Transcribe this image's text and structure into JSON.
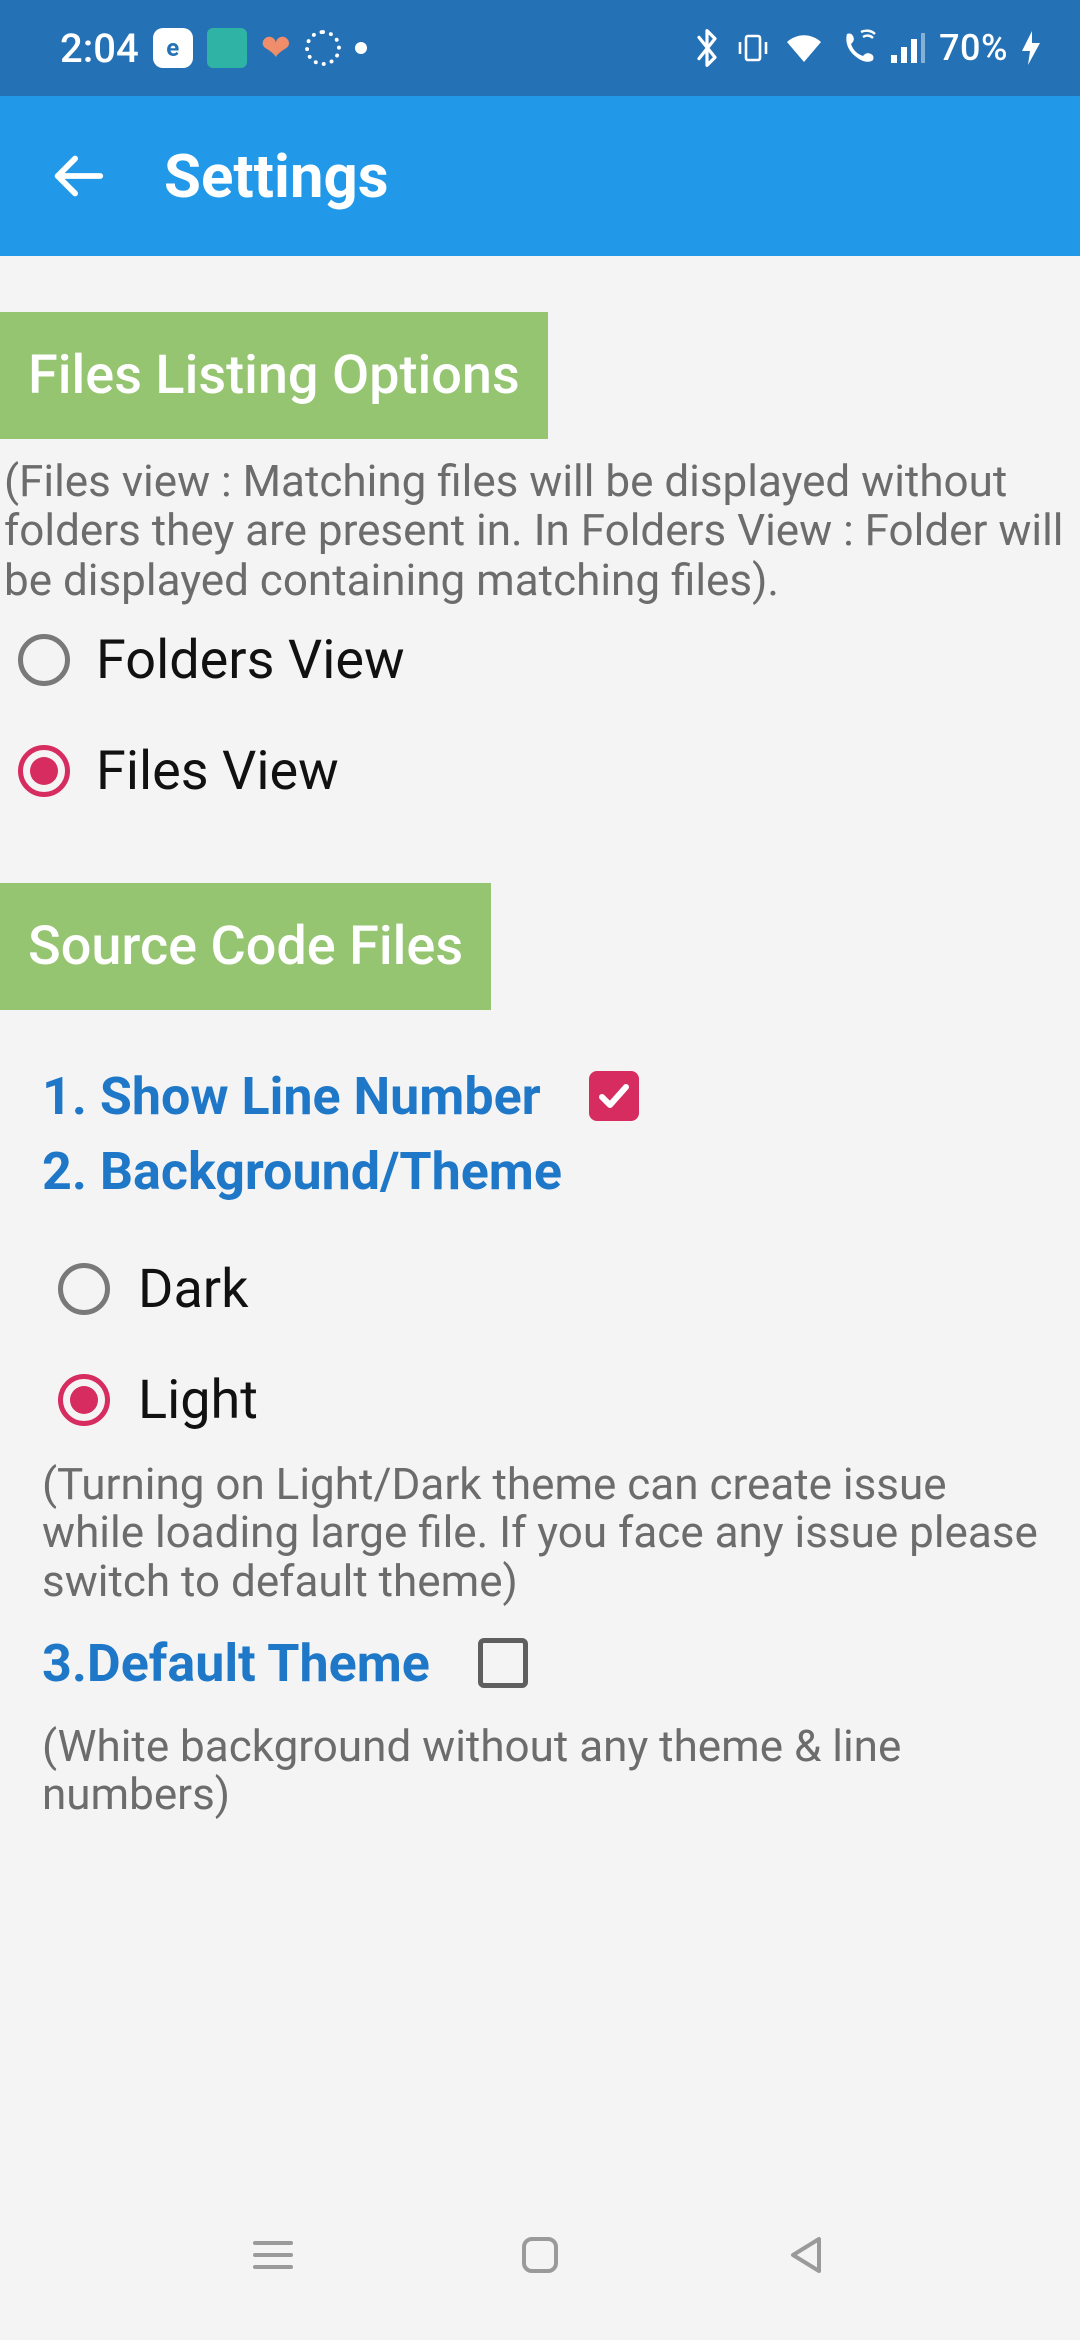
{
  "status": {
    "time": "2:04",
    "battery": "70%"
  },
  "appbar": {
    "title": "Settings"
  },
  "section_files": {
    "header": "Files Listing Options",
    "desc": "(Files view : Matching files will be displayed without folders they are present in. In Folders View : Folder will be displayed containing matching files).",
    "radio_folders": "Folders View",
    "radio_files": "Files View"
  },
  "section_source": {
    "header": "Source Code Files",
    "item1": "1. Show Line Number",
    "item2": "2. Background/Theme",
    "radio_dark": "Dark",
    "radio_light": "Light",
    "theme_note": "(Turning on Light/Dark theme can create issue while loading large file. If you face any issue please switch to default theme)",
    "item3": "3.Default Theme",
    "default_note": "(White background without any theme & line numbers)"
  }
}
